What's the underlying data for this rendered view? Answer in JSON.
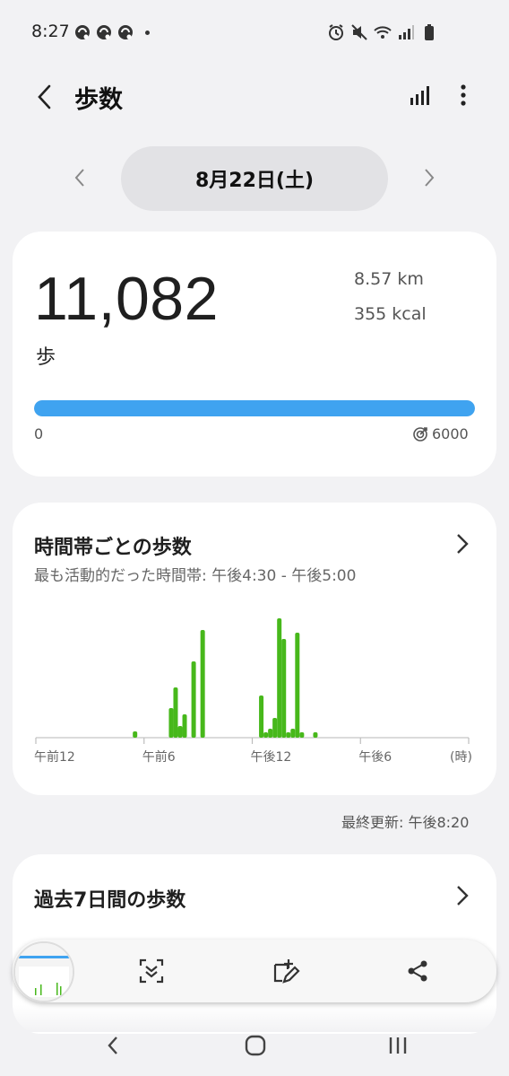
{
  "status_bar": {
    "time": "8:27",
    "notification_icons": [
      "app-notification-icon",
      "app-notification-icon",
      "app-notification-icon"
    ],
    "system_icons": [
      "alarm-icon",
      "mute-icon",
      "wifi-icon",
      "signal-icon",
      "battery-icon"
    ]
  },
  "header": {
    "title": "歩数"
  },
  "date_nav": {
    "date": "8月22日(土)"
  },
  "summary": {
    "steps": "11,082",
    "unit": "歩",
    "distance": "8.57 km",
    "calories": "355 kcal",
    "progress_min": "0",
    "goal": "6000",
    "progress_fraction": 1.0,
    "accent_color": "#3fa3f0"
  },
  "hourly": {
    "title": "時間帯ごとの歩数",
    "subtitle": "最も活動的だった時間帯: 午後4:30 - 午後5:00",
    "last_updated": "最終更新: 午後8:20"
  },
  "chart_data": {
    "type": "bar",
    "x_tick_labels": [
      "午前12",
      "午前6",
      "午後12",
      "午後6"
    ],
    "x_unit": "(時)",
    "bar_color": "#47b81b",
    "x": [
      11.0,
      15.0,
      15.5,
      16.0,
      16.5,
      17.5,
      18.5,
      25.0,
      25.5,
      26.0,
      26.5,
      27.0,
      27.5,
      28.0,
      28.5,
      29.0,
      29.5,
      30.0,
      31.0
    ],
    "values": [
      7,
      33,
      56,
      13,
      26,
      85,
      120,
      47,
      6,
      10,
      22,
      133,
      110,
      6,
      10,
      117,
      6,
      0,
      6
    ],
    "ylim": [
      0,
      140
    ]
  },
  "weekly": {
    "title": "過去7日間の歩数"
  },
  "screenshot_toolbar": {
    "tools": [
      "scroll-capture-icon",
      "draw-edit-icon",
      "share-icon"
    ]
  },
  "nav_bar": {
    "buttons": [
      "back",
      "home",
      "recents"
    ]
  }
}
